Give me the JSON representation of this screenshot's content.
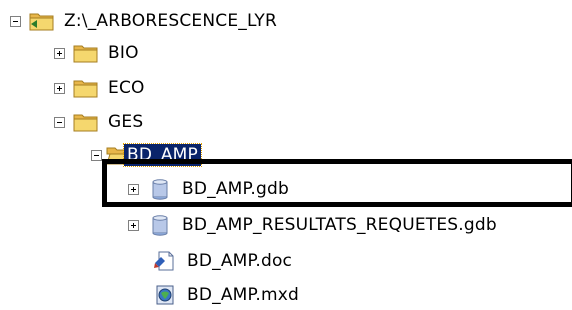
{
  "tree": {
    "root": {
      "label": "Z:\\_ARBORESCENCE_LYR",
      "expanded": true,
      "icon": "network-drive-folder-icon"
    },
    "bio": {
      "label": "BIO",
      "expanded": false,
      "icon": "folder-icon"
    },
    "eco": {
      "label": "ECO",
      "expanded": false,
      "icon": "folder-icon"
    },
    "ges": {
      "label": "GES",
      "expanded": true,
      "icon": "folder-icon"
    },
    "bd_amp": {
      "label": "BD_AMP",
      "expanded": true,
      "selected": true,
      "icon": "open-folder-icon"
    },
    "gdb1": {
      "label": "BD_AMP.gdb",
      "expanded": false,
      "highlighted": true,
      "icon": "file-geodatabase-icon"
    },
    "gdb2": {
      "label": "BD_AMP_RESULTATS_REQUETES.gdb",
      "expanded": false,
      "icon": "file-geodatabase-icon"
    },
    "doc": {
      "label": "BD_AMP.doc",
      "icon": "document-icon"
    },
    "mxd": {
      "label": "BD_AMP.mxd",
      "icon": "arcmap-document-icon"
    }
  },
  "colors": {
    "selection_bg": "#0a246a",
    "selection_text": "#ffffff",
    "folder_yellow": "#f5d76e",
    "geodatabase_blue": "#8aa6d6",
    "annotation_border": "#000000"
  }
}
